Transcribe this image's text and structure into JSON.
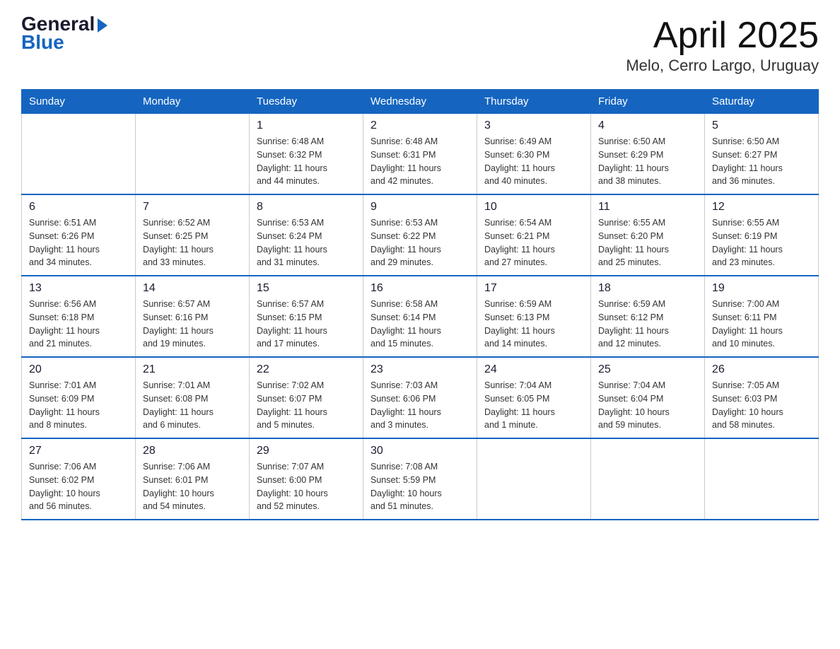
{
  "header": {
    "logo_general": "General",
    "logo_arrow": "▶",
    "logo_blue": "Blue",
    "title": "April 2025",
    "subtitle": "Melo, Cerro Largo, Uruguay"
  },
  "weekdays": [
    "Sunday",
    "Monday",
    "Tuesday",
    "Wednesday",
    "Thursday",
    "Friday",
    "Saturday"
  ],
  "weeks": [
    [
      {
        "day": "",
        "info": ""
      },
      {
        "day": "",
        "info": ""
      },
      {
        "day": "1",
        "info": "Sunrise: 6:48 AM\nSunset: 6:32 PM\nDaylight: 11 hours\nand 44 minutes."
      },
      {
        "day": "2",
        "info": "Sunrise: 6:48 AM\nSunset: 6:31 PM\nDaylight: 11 hours\nand 42 minutes."
      },
      {
        "day": "3",
        "info": "Sunrise: 6:49 AM\nSunset: 6:30 PM\nDaylight: 11 hours\nand 40 minutes."
      },
      {
        "day": "4",
        "info": "Sunrise: 6:50 AM\nSunset: 6:29 PM\nDaylight: 11 hours\nand 38 minutes."
      },
      {
        "day": "5",
        "info": "Sunrise: 6:50 AM\nSunset: 6:27 PM\nDaylight: 11 hours\nand 36 minutes."
      }
    ],
    [
      {
        "day": "6",
        "info": "Sunrise: 6:51 AM\nSunset: 6:26 PM\nDaylight: 11 hours\nand 34 minutes."
      },
      {
        "day": "7",
        "info": "Sunrise: 6:52 AM\nSunset: 6:25 PM\nDaylight: 11 hours\nand 33 minutes."
      },
      {
        "day": "8",
        "info": "Sunrise: 6:53 AM\nSunset: 6:24 PM\nDaylight: 11 hours\nand 31 minutes."
      },
      {
        "day": "9",
        "info": "Sunrise: 6:53 AM\nSunset: 6:22 PM\nDaylight: 11 hours\nand 29 minutes."
      },
      {
        "day": "10",
        "info": "Sunrise: 6:54 AM\nSunset: 6:21 PM\nDaylight: 11 hours\nand 27 minutes."
      },
      {
        "day": "11",
        "info": "Sunrise: 6:55 AM\nSunset: 6:20 PM\nDaylight: 11 hours\nand 25 minutes."
      },
      {
        "day": "12",
        "info": "Sunrise: 6:55 AM\nSunset: 6:19 PM\nDaylight: 11 hours\nand 23 minutes."
      }
    ],
    [
      {
        "day": "13",
        "info": "Sunrise: 6:56 AM\nSunset: 6:18 PM\nDaylight: 11 hours\nand 21 minutes."
      },
      {
        "day": "14",
        "info": "Sunrise: 6:57 AM\nSunset: 6:16 PM\nDaylight: 11 hours\nand 19 minutes."
      },
      {
        "day": "15",
        "info": "Sunrise: 6:57 AM\nSunset: 6:15 PM\nDaylight: 11 hours\nand 17 minutes."
      },
      {
        "day": "16",
        "info": "Sunrise: 6:58 AM\nSunset: 6:14 PM\nDaylight: 11 hours\nand 15 minutes."
      },
      {
        "day": "17",
        "info": "Sunrise: 6:59 AM\nSunset: 6:13 PM\nDaylight: 11 hours\nand 14 minutes."
      },
      {
        "day": "18",
        "info": "Sunrise: 6:59 AM\nSunset: 6:12 PM\nDaylight: 11 hours\nand 12 minutes."
      },
      {
        "day": "19",
        "info": "Sunrise: 7:00 AM\nSunset: 6:11 PM\nDaylight: 11 hours\nand 10 minutes."
      }
    ],
    [
      {
        "day": "20",
        "info": "Sunrise: 7:01 AM\nSunset: 6:09 PM\nDaylight: 11 hours\nand 8 minutes."
      },
      {
        "day": "21",
        "info": "Sunrise: 7:01 AM\nSunset: 6:08 PM\nDaylight: 11 hours\nand 6 minutes."
      },
      {
        "day": "22",
        "info": "Sunrise: 7:02 AM\nSunset: 6:07 PM\nDaylight: 11 hours\nand 5 minutes."
      },
      {
        "day": "23",
        "info": "Sunrise: 7:03 AM\nSunset: 6:06 PM\nDaylight: 11 hours\nand 3 minutes."
      },
      {
        "day": "24",
        "info": "Sunrise: 7:04 AM\nSunset: 6:05 PM\nDaylight: 11 hours\nand 1 minute."
      },
      {
        "day": "25",
        "info": "Sunrise: 7:04 AM\nSunset: 6:04 PM\nDaylight: 10 hours\nand 59 minutes."
      },
      {
        "day": "26",
        "info": "Sunrise: 7:05 AM\nSunset: 6:03 PM\nDaylight: 10 hours\nand 58 minutes."
      }
    ],
    [
      {
        "day": "27",
        "info": "Sunrise: 7:06 AM\nSunset: 6:02 PM\nDaylight: 10 hours\nand 56 minutes."
      },
      {
        "day": "28",
        "info": "Sunrise: 7:06 AM\nSunset: 6:01 PM\nDaylight: 10 hours\nand 54 minutes."
      },
      {
        "day": "29",
        "info": "Sunrise: 7:07 AM\nSunset: 6:00 PM\nDaylight: 10 hours\nand 52 minutes."
      },
      {
        "day": "30",
        "info": "Sunrise: 7:08 AM\nSunset: 5:59 PM\nDaylight: 10 hours\nand 51 minutes."
      },
      {
        "day": "",
        "info": ""
      },
      {
        "day": "",
        "info": ""
      },
      {
        "day": "",
        "info": ""
      }
    ]
  ]
}
